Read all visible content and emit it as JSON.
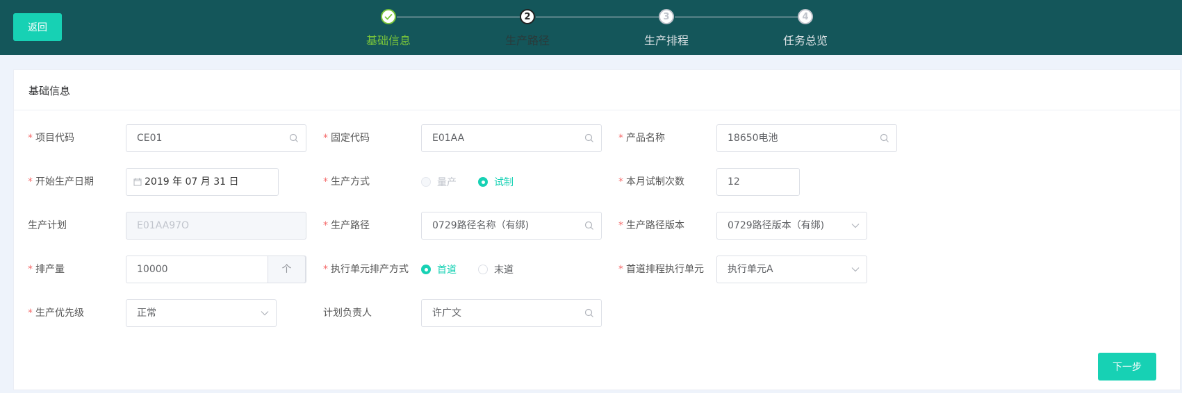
{
  "header": {
    "back_label": "返回",
    "steps": [
      {
        "label": "基础信息",
        "state": "done",
        "number": ""
      },
      {
        "label": "生产路径",
        "state": "active",
        "number": "2"
      },
      {
        "label": "生产排程",
        "state": "todo",
        "number": "3"
      },
      {
        "label": "任务总览",
        "state": "todo",
        "number": "4"
      }
    ]
  },
  "card": {
    "title": "基础信息",
    "fields": {
      "project_code": {
        "label": "项目代码",
        "value": "CE01"
      },
      "fixed_code": {
        "label": "固定代码",
        "value": "E01AA"
      },
      "product_name": {
        "label": "产品名称",
        "value": "18650电池"
      },
      "start_date": {
        "label": "开始生产日期",
        "value": "2019 年 07 月 31 日"
      },
      "production_mode": {
        "label": "生产方式",
        "options": [
          "量产",
          "试制"
        ],
        "selected": "试制"
      },
      "trial_count": {
        "label": "本月试制次数",
        "value": "12"
      },
      "production_plan": {
        "label": "生产计划",
        "value": "E01AA97O"
      },
      "production_path": {
        "label": "生产路径",
        "value": "0729路径名称（有绑)"
      },
      "path_version": {
        "label": "生产路径版本",
        "value": "0729路径版本（有绑)"
      },
      "schedule_qty": {
        "label": "排产量",
        "value": "10000",
        "unit": "个"
      },
      "exec_mode": {
        "label": "执行单元排产方式",
        "options": [
          "首道",
          "末道"
        ],
        "selected": "首道"
      },
      "first_exec_unit": {
        "label": "首道排程执行单元",
        "value": "执行单元A"
      },
      "priority": {
        "label": "生产优先级",
        "value": "正常"
      },
      "planner": {
        "label": "计划负责人",
        "value": "许广文"
      }
    },
    "next_label": "下一步"
  },
  "colors": {
    "header_bg": "#14565a",
    "accent": "#17d1b4",
    "done_green": "#7ac53a",
    "required": "#f56c6c"
  }
}
